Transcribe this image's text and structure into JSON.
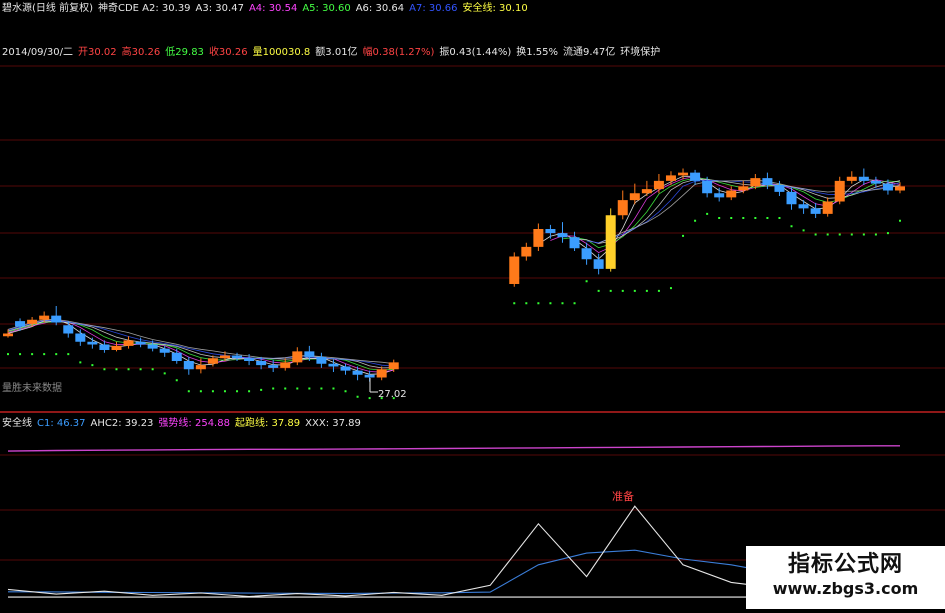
{
  "colors": {
    "up": "#ff7a1a",
    "down": "#3b9dff",
    "special": "#ffd02a",
    "separator": "#8b0c0c",
    "safety_dots": "#33ff33",
    "purple_line": "#cc44cc",
    "blue_line": "#3b7dd8",
    "white_line": "#e6e6e6"
  },
  "header_row1": [
    {
      "text": "碧水源(日线 前复权)",
      "color": "#e6e6e6"
    },
    {
      "text": "神奇CDE A2: 30.39",
      "color": "#e6e6e6"
    },
    {
      "text": "A3: 30.47",
      "color": "#e6e6e6"
    },
    {
      "text": "A4: 30.54",
      "color": "#ff44ff"
    },
    {
      "text": "A5: 30.60",
      "color": "#44ff44"
    },
    {
      "text": "A6: 30.64",
      "color": "#e6e6e6"
    },
    {
      "text": "A7: 30.66",
      "color": "#3355ff"
    },
    {
      "text": "安全线: 30.10",
      "color": "#ffff44"
    }
  ],
  "header_row2": [
    {
      "text": "2014/09/30/二",
      "color": "#e6e6e6"
    },
    {
      "text": "开30.02",
      "color": "#ff4444"
    },
    {
      "text": "高30.26",
      "color": "#ff4444"
    },
    {
      "text": "低29.83",
      "color": "#44ff44"
    },
    {
      "text": "收30.26",
      "color": "#ff4444"
    },
    {
      "text": "量100030.8",
      "color": "#ffff44"
    },
    {
      "text": "额3.01亿",
      "color": "#e6e6e6"
    },
    {
      "text": "幅0.38(1.27%)",
      "color": "#ff4444"
    },
    {
      "text": "振0.43(1.44%)",
      "color": "#e6e6e6"
    },
    {
      "text": "换1.55%",
      "color": "#e6e6e6"
    },
    {
      "text": "流通9.47亿",
      "color": "#e6e6e6"
    },
    {
      "text": "环境保护",
      "color": "#e6e6e6"
    }
  ],
  "lower_header": [
    {
      "text": "安全线",
      "color": "#e6e6e6"
    },
    {
      "text": "C1: 46.37",
      "color": "#3b9dff"
    },
    {
      "text": "AHC2: 39.23",
      "color": "#e6e6e6"
    },
    {
      "text": "强势线: 254.88",
      "color": "#ff44ff"
    },
    {
      "text": "起跑线: 37.89",
      "color": "#ffff44"
    },
    {
      "text": "XXX: 37.89",
      "color": "#e6e6e6"
    }
  ],
  "annotations": {
    "low_price": "27.02",
    "left_label": "量胜未来数据",
    "peak_label": "准备"
  },
  "watermark": {
    "title": "指标公式网",
    "url": "www.zbgs3.com"
  },
  "chart_data": [
    {
      "type": "candlestick",
      "x": [
        1,
        2,
        3,
        4,
        5,
        6,
        7,
        8,
        9,
        10,
        11,
        12,
        13,
        14,
        15,
        16,
        17,
        18,
        19,
        20,
        21,
        22,
        23,
        24,
        25,
        26,
        27,
        28,
        29,
        30,
        31,
        32,
        33,
        34,
        35,
        36,
        37,
        38,
        39,
        40,
        41,
        42,
        43,
        44,
        45,
        46,
        47,
        48,
        49,
        50,
        51,
        52,
        53,
        54,
        55,
        56,
        57,
        58,
        59,
        60,
        61,
        62,
        63,
        64,
        65,
        66,
        67,
        68,
        69,
        70,
        71,
        72,
        73,
        74,
        75
      ],
      "candles": [
        [
          29.0,
          29.2,
          29.5,
          28.9
        ],
        [
          30.1,
          29.7,
          30.3,
          29.4
        ],
        [
          29.9,
          30.2,
          30.4,
          29.7
        ],
        [
          30.2,
          30.5,
          30.8,
          30.0
        ],
        [
          30.5,
          30.0,
          31.2,
          29.8
        ],
        [
          29.8,
          29.2,
          30.1,
          28.9
        ],
        [
          29.2,
          28.6,
          29.5,
          28.3
        ],
        [
          28.6,
          28.4,
          28.9,
          28.1
        ],
        [
          28.4,
          28.0,
          28.7,
          27.8
        ],
        [
          28.0,
          28.3,
          28.6,
          27.9
        ],
        [
          28.3,
          28.7,
          29.0,
          28.1
        ],
        [
          28.6,
          28.4,
          28.9,
          28.2
        ],
        [
          28.4,
          28.1,
          28.7,
          27.9
        ],
        [
          28.1,
          27.8,
          28.3,
          27.5
        ],
        [
          27.8,
          27.2,
          28.1,
          27.0
        ],
        [
          27.2,
          26.6,
          27.5,
          26.2
        ],
        [
          26.6,
          26.9,
          27.4,
          26.3
        ],
        [
          27.0,
          27.4,
          27.6,
          26.8
        ],
        [
          27.4,
          27.6,
          27.9,
          27.2
        ],
        [
          27.6,
          27.4,
          27.8,
          27.2
        ],
        [
          27.4,
          27.2,
          27.7,
          26.9
        ],
        [
          27.2,
          26.9,
          27.5,
          26.6
        ],
        [
          26.9,
          26.7,
          27.3,
          26.4
        ],
        [
          26.7,
          27.1,
          27.4,
          26.5
        ],
        [
          27.1,
          27.9,
          28.2,
          26.9
        ],
        [
          27.9,
          27.5,
          28.3,
          27.2
        ],
        [
          27.5,
          27.0,
          27.8,
          26.7
        ],
        [
          27.0,
          26.8,
          27.3,
          26.4
        ],
        [
          26.8,
          26.5,
          27.0,
          26.2
        ],
        [
          26.5,
          26.2,
          26.8,
          25.8
        ],
        [
          26.2,
          26.0,
          26.5,
          25.7
        ],
        [
          26.0,
          26.6,
          26.8,
          25.8
        ],
        [
          26.6,
          27.1,
          27.3,
          26.4
        ],
        [
          null,
          null,
          null,
          null
        ],
        [
          null,
          null,
          null,
          null
        ],
        [
          null,
          null,
          null,
          null
        ],
        [
          null,
          null,
          null,
          null
        ],
        [
          null,
          null,
          null,
          null
        ],
        [
          null,
          null,
          null,
          null
        ],
        [
          null,
          null,
          null,
          null
        ],
        [
          null,
          null,
          null,
          null
        ],
        [
          null,
          null,
          null,
          null
        ],
        [
          32.8,
          34.8,
          35.1,
          32.6
        ],
        [
          34.8,
          35.5,
          35.8,
          34.5
        ],
        [
          35.5,
          36.8,
          37.2,
          35.2
        ],
        [
          36.8,
          36.5,
          37.1,
          36.1
        ],
        [
          36.5,
          36.2,
          37.3,
          35.8
        ],
        [
          36.2,
          35.4,
          36.6,
          35.2
        ],
        [
          35.4,
          34.6,
          35.8,
          34.2
        ],
        [
          34.6,
          33.9,
          35.0,
          33.5
        ],
        [
          33.9,
          37.8,
          38.3,
          33.7
        ],
        [
          37.8,
          38.9,
          39.6,
          37.5
        ],
        [
          38.9,
          39.4,
          40.1,
          38.6
        ],
        [
          39.4,
          39.7,
          40.3,
          39.2
        ],
        [
          39.7,
          40.3,
          40.8,
          39.4
        ],
        [
          40.3,
          40.7,
          41.0,
          40.0
        ],
        [
          40.7,
          40.9,
          41.2,
          40.4
        ],
        [
          40.9,
          40.3,
          41.1,
          40.0
        ],
        [
          40.3,
          39.4,
          40.6,
          39.1
        ],
        [
          39.4,
          39.1,
          39.8,
          38.8
        ],
        [
          39.1,
          39.6,
          39.9,
          38.9
        ],
        [
          39.6,
          39.9,
          40.3,
          39.4
        ],
        [
          39.9,
          40.5,
          40.8,
          39.7
        ],
        [
          40.5,
          40.0,
          40.9,
          39.7
        ],
        [
          40.0,
          39.5,
          40.3,
          39.2
        ],
        [
          39.5,
          38.6,
          39.8,
          38.2
        ],
        [
          38.6,
          38.3,
          38.9,
          37.9
        ],
        [
          38.3,
          37.9,
          38.7,
          37.6
        ],
        [
          37.9,
          38.8,
          39.1,
          37.7
        ],
        [
          38.8,
          40.3,
          40.6,
          38.6
        ],
        [
          40.3,
          40.6,
          41.0,
          40.1
        ],
        [
          40.6,
          40.3,
          41.2,
          40.0
        ],
        [
          40.3,
          40.1,
          40.6,
          39.8
        ],
        [
          40.1,
          39.6,
          40.4,
          39.3
        ],
        [
          39.6,
          39.9,
          40.2,
          39.4
        ]
      ],
      "ylim": [
        24,
        44
      ]
    },
    {
      "type": "line",
      "x": [
        1,
        5,
        9,
        13,
        17,
        21,
        25,
        29,
        33,
        37,
        41,
        45,
        49,
        53,
        57,
        61,
        65,
        69,
        73,
        75
      ],
      "series": [
        {
          "name": "强势线",
          "values": [
            254,
            255,
            255.5,
            256,
            256.5,
            257,
            257,
            257.5,
            258,
            258.5,
            259,
            259.5,
            260,
            260.5,
            261,
            261.5,
            262,
            262.5,
            263,
            263
          ]
        },
        {
          "name": "C1",
          "values": [
            14,
            13.8,
            13.2,
            12.8,
            12.2,
            11.8,
            11.5,
            11.2,
            11.8,
            12.2,
            13.5,
            60,
            80,
            85,
            70,
            60,
            45,
            40,
            35,
            33
          ]
        },
        {
          "name": "AHC2",
          "values": [
            18,
            10,
            15,
            8,
            12,
            6,
            11,
            7,
            13,
            8,
            25,
            130,
            40,
            160,
            60,
            30,
            20,
            35,
            25,
            30
          ]
        },
        {
          "name": "起跑线",
          "values": [
            5,
            5,
            5,
            5,
            5,
            5,
            5,
            5,
            5,
            5,
            5,
            5,
            5,
            5,
            5,
            5,
            5,
            5,
            5,
            5
          ]
        }
      ],
      "ylim": [
        0,
        290
      ]
    }
  ]
}
